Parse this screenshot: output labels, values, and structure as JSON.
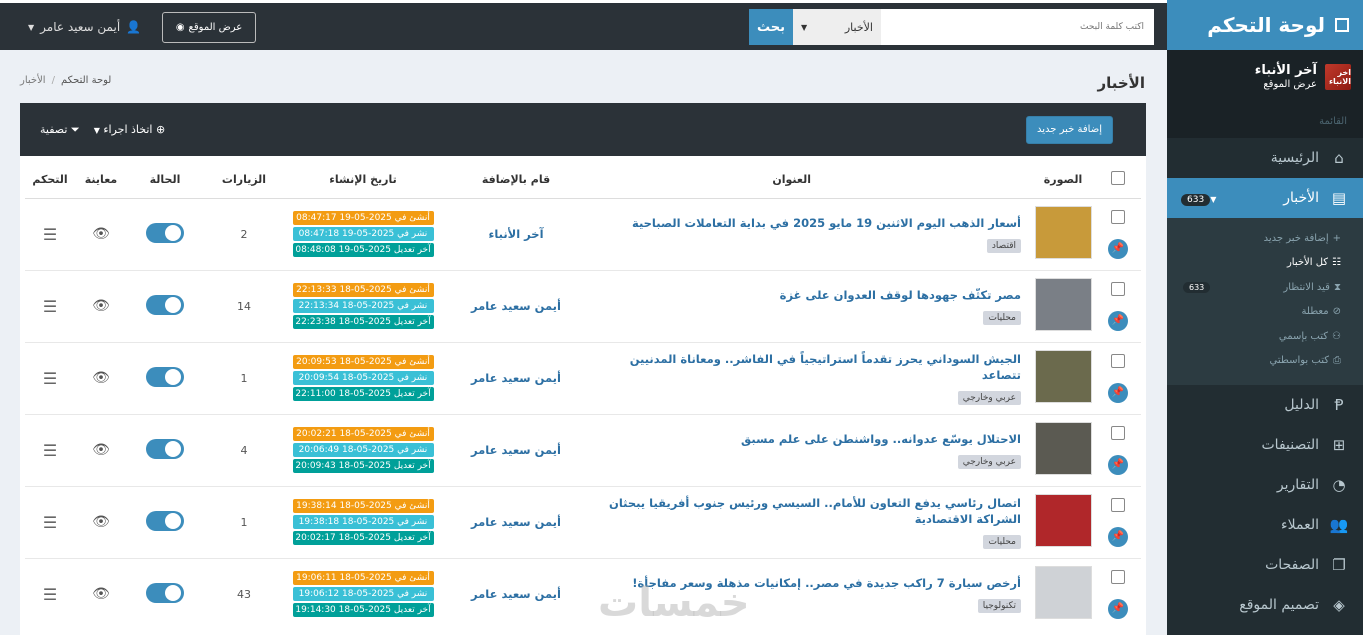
{
  "sidebar": {
    "brand": "لوحة التحكم",
    "site_name": "آخر الأنباء",
    "site_sub": "عرض الموقع",
    "site_logo_text": "اخر الانباء",
    "menu_header": "القائمة",
    "items": [
      {
        "label": "الرئيسية",
        "icon": "home-icon",
        "glyph": "⌂"
      },
      {
        "label": "الأخبار",
        "icon": "newspaper-icon",
        "glyph": "▤",
        "badge": "633",
        "active": true
      },
      {
        "label": "الدليل",
        "icon": "paypal-icon",
        "glyph": "Ᵽ"
      },
      {
        "label": "التصنيفات",
        "icon": "sitemap-icon",
        "glyph": "⊞"
      },
      {
        "label": "التقارير",
        "icon": "pie-chart-icon",
        "glyph": "◔"
      },
      {
        "label": "العملاء",
        "icon": "users-icon",
        "glyph": "👥"
      },
      {
        "label": "الصفحات",
        "icon": "copy-icon",
        "glyph": "❐"
      },
      {
        "label": "تصميم الموقع",
        "icon": "layers-icon",
        "glyph": "◈"
      }
    ],
    "submenu": [
      {
        "label": "إضافة خبر جديد",
        "glyph": "+"
      },
      {
        "label": "كل الأخبار",
        "glyph": "☷",
        "active": true
      },
      {
        "label": "قيد الانتظار",
        "glyph": "⧗",
        "badge": "633"
      },
      {
        "label": "معطلة",
        "glyph": "⊘"
      },
      {
        "label": "كتب بإسمي",
        "glyph": "⚇"
      },
      {
        "label": "كتب بواسطتي",
        "glyph": "⎙"
      }
    ]
  },
  "topbar": {
    "search_placeholder": "أكتب كلمة البحث",
    "search_scope": "الأخبار",
    "search_button": "بحث",
    "view_site": "عرض الموقع",
    "user_name": "أيمن سعيد عامر"
  },
  "page": {
    "title": "الأخبار",
    "breadcrumb_home": "لوحة التحكم",
    "breadcrumb_current": "الأخبار",
    "add_button": "إضافة خبر جديد",
    "actions_label": "اتخاذ اجراء",
    "filter_label": "تصفية"
  },
  "table": {
    "headers": {
      "image": "الصورة",
      "title": "العنوان",
      "author": "قام بالإضافة",
      "created": "تاريخ الإنشاء",
      "visits": "الزيارات",
      "status": "الحالة",
      "preview": "معاينة",
      "control": "التحكم"
    },
    "rows": [
      {
        "title": "أسعار الذهب اليوم الاثنين 19 مايو 2025 في بداية التعاملات الصباحية",
        "category": "اقتصاد",
        "author": "آخر الأنباء",
        "created": "أنشئ في 2025-05-19 08:47:17",
        "published": "نشر في 2025-05-19 08:47:18",
        "edited": "آخر تعديل 2025-05-19 08:48:08",
        "visits": "2",
        "thumb": "#c89a3a"
      },
      {
        "title": "مصر تكثّف جهودها لوقف العدوان على غزة",
        "category": "محليات",
        "author": "أيمن سعيد عامر",
        "created": "أنشئ في 2025-05-18 22:13:33",
        "published": "نشر في 2025-05-18 22:13:34",
        "edited": "آخر تعديل 2025-05-18 22:23:38",
        "visits": "14",
        "thumb": "#7a7f86"
      },
      {
        "title": "الجيش السوداني يحرز تقدماً استراتيجياً في الفاشر.. ومعاناة المدنيين تتصاعد",
        "category": "عربي وخارجي",
        "author": "أيمن سعيد عامر",
        "created": "أنشئ في 2025-05-18 20:09:53",
        "published": "نشر في 2025-05-18 20:09:54",
        "edited": "آخر تعديل 2025-05-18 22:11:00",
        "visits": "1",
        "thumb": "#6b6a4d"
      },
      {
        "title": "الاحتلال يوسّع عدوانه.. وواشنطن على علم مسبق",
        "category": "عربي وخارجي",
        "author": "أيمن سعيد عامر",
        "created": "أنشئ في 2025-05-18 20:02:21",
        "published": "نشر في 2025-05-18 20:06:49",
        "edited": "آخر تعديل 2025-05-18 20:09:43",
        "visits": "4",
        "thumb": "#5b5a52"
      },
      {
        "title": "اتصال رئاسي يدفع التعاون للأمام.. السيسي ورئيس جنوب أفريقيا يبحثان الشراكة الاقتصادية",
        "category": "محليات",
        "author": "أيمن سعيد عامر",
        "created": "أنشئ في 2025-05-18 19:38:14",
        "published": "نشر في 2025-05-18 19:38:18",
        "edited": "آخر تعديل 2025-05-18 20:02:17",
        "visits": "1",
        "thumb": "#b0272a"
      },
      {
        "title": "أرخص سيارة 7 راكب جديدة في مصر.. إمكانيات مذهلة وسعر مفاجأة!",
        "category": "تكنولوجيا",
        "author": "أيمن سعيد عامر",
        "created": "أنشئ في 2025-05-18 19:06:11",
        "published": "نشر في 2025-05-18 19:06:12",
        "edited": "آخر تعديل 2025-05-18 19:14:30",
        "visits": "43",
        "thumb": "#cfd2d6"
      }
    ]
  },
  "watermark": "خمسات",
  "colors": {
    "accent": "#3c8dbc",
    "sidebar": "#222d32",
    "topbar": "#2b3238",
    "created": "#f39c12",
    "published": "#3ac0d6",
    "edited": "#00a099"
  }
}
